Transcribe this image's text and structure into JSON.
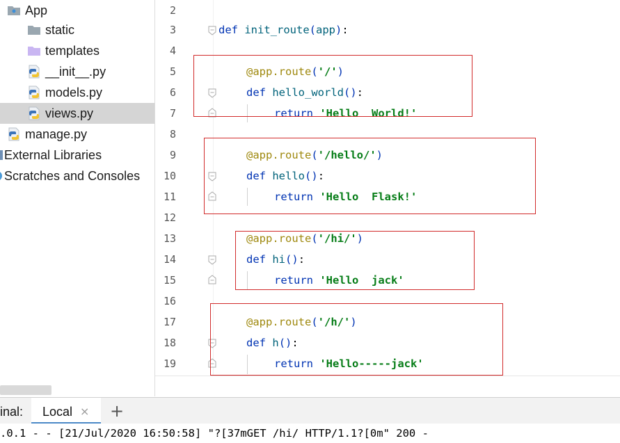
{
  "project_tree": {
    "items": [
      {
        "label": "App",
        "icon": "folder-icon",
        "selected": false
      },
      {
        "label": "static",
        "icon": "folder-icon",
        "selected": false
      },
      {
        "label": "templates",
        "icon": "templates-folder-icon",
        "selected": false
      },
      {
        "label": "__init__.py",
        "icon": "python-file-icon",
        "selected": false
      },
      {
        "label": "models.py",
        "icon": "python-file-icon",
        "selected": false
      },
      {
        "label": "views.py",
        "icon": "python-file-icon",
        "selected": true
      },
      {
        "label": "manage.py",
        "icon": "python-file-icon",
        "selected": false
      },
      {
        "label": "External Libraries",
        "icon": "library-icon",
        "selected": false
      },
      {
        "label": "Scratches and Consoles",
        "icon": "scratches-icon",
        "selected": false
      }
    ]
  },
  "editor": {
    "line_numbers": [
      "2",
      "3",
      "4",
      "5",
      "6",
      "7",
      "8",
      "9",
      "10",
      "11",
      "12",
      "13",
      "14",
      "15",
      "16",
      "17",
      "18",
      "19"
    ],
    "code": {
      "l3": {
        "kw": "def",
        "name": "init_route",
        "open": "(",
        "param": "app",
        "close": ")",
        "colon": ":"
      },
      "l5": {
        "dec": "@app.route",
        "open": "(",
        "str": "'/'",
        "close": ")"
      },
      "l6": {
        "kw": "def",
        "name": "hello_world",
        "parens": "()",
        "colon": ":"
      },
      "l7": {
        "kw": "return",
        "str": "'Hello  World!'"
      },
      "l9": {
        "dec": "@app.route",
        "open": "(",
        "str": "'/hello/'",
        "close": ")"
      },
      "l10": {
        "kw": "def",
        "name": "hello",
        "parens": "()",
        "colon": ":"
      },
      "l11": {
        "kw": "return",
        "str": "'Hello  Flask!'"
      },
      "l13": {
        "dec": "@app.route",
        "open": "(",
        "str": "'/hi/'",
        "close": ")"
      },
      "l14": {
        "kw": "def",
        "name": "hi",
        "parens": "()",
        "colon": ":"
      },
      "l15": {
        "kw": "return",
        "str": "'Hello  jack'"
      },
      "l17": {
        "dec": "@app.route",
        "open": "(",
        "str": "'/h/'",
        "close": ")"
      },
      "l18": {
        "kw": "def",
        "name": "h",
        "parens": "()",
        "colon": ":"
      },
      "l19": {
        "kw": "return",
        "str": "'Hello-----jack'"
      }
    }
  },
  "terminal": {
    "panel_label": "inal:",
    "tab_label": "Local",
    "close_glyph": "×",
    "add_glyph": "+",
    "output_line": ".0.1 - - [21/Jul/2020 16:50:58] \"?[37mGET /hi/ HTTP/1.1?[0m\" 200 -"
  },
  "colors": {
    "keyword": "#0033b3",
    "decorator": "#9e880d",
    "function_name": "#00627a",
    "string": "#067d17",
    "annotation_box": "#d12a2a",
    "selection": "#d5d5d5"
  }
}
